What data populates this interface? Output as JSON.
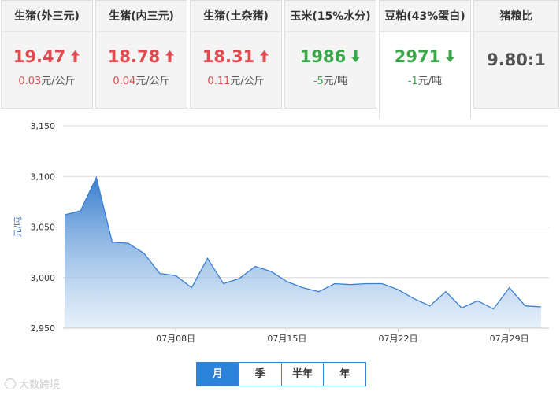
{
  "cards": [
    {
      "title": "生猪(外三元)",
      "price": "19.47",
      "direction": "up",
      "change": "0.03",
      "unit": "元/公斤"
    },
    {
      "title": "生猪(内三元)",
      "price": "18.78",
      "direction": "up",
      "change": "0.04",
      "unit": "元/公斤"
    },
    {
      "title": "生猪(土杂猪)",
      "price": "18.31",
      "direction": "up",
      "change": "0.11",
      "unit": "元/公斤"
    },
    {
      "title": "玉米(15%水分)",
      "price": "1986",
      "direction": "down",
      "change": "-5",
      "unit": "元/吨"
    },
    {
      "title": "豆粕(43%蛋白)",
      "price": "2971",
      "direction": "down",
      "change": "-1",
      "unit": "元/吨",
      "active": true
    },
    {
      "title": "猪粮比",
      "price": "9.80:1",
      "direction": "none"
    }
  ],
  "colors": {
    "up": "#e24a4f",
    "down": "#3aa74a",
    "line": "#3a7fd0",
    "tab_active": "#2d83d9"
  },
  "chart_data": {
    "type": "area",
    "ylabel": "元/吨",
    "ylim": [
      2950,
      3150
    ],
    "yticks": [
      2950,
      3000,
      3050,
      3100,
      3150
    ],
    "ytick_labels": [
      "2,950",
      "3,000",
      "3,050",
      "3,100",
      "3,150"
    ],
    "xtick_labels": [
      "07月08日",
      "07月15日",
      "07月22日",
      "07月29日"
    ],
    "xtick_days": [
      8,
      15,
      22,
      29
    ],
    "grid": true,
    "x_days": [
      2,
      3,
      4,
      5,
      6,
      7,
      8,
      9,
      10,
      11,
      12,
      13,
      14,
      15,
      16,
      17,
      18,
      19,
      20,
      21,
      22,
      23,
      24,
      25,
      26,
      27,
      28,
      29,
      30,
      31
    ],
    "values": [
      3062,
      3066,
      3099,
      3035,
      3034,
      3024,
      3004,
      3002,
      2990,
      3019,
      2994,
      2999,
      3011,
      3006,
      2996,
      2990,
      2986,
      2994,
      2993,
      2994,
      2994,
      2988,
      2979,
      2972,
      2986,
      2970,
      2977,
      2969,
      2990,
      2972,
      2971
    ]
  },
  "range_tabs": [
    {
      "label": "月",
      "active": true
    },
    {
      "label": "季",
      "active": false
    },
    {
      "label": "半年",
      "active": false
    },
    {
      "label": "年",
      "active": false
    }
  ],
  "watermark": "大数跨境"
}
